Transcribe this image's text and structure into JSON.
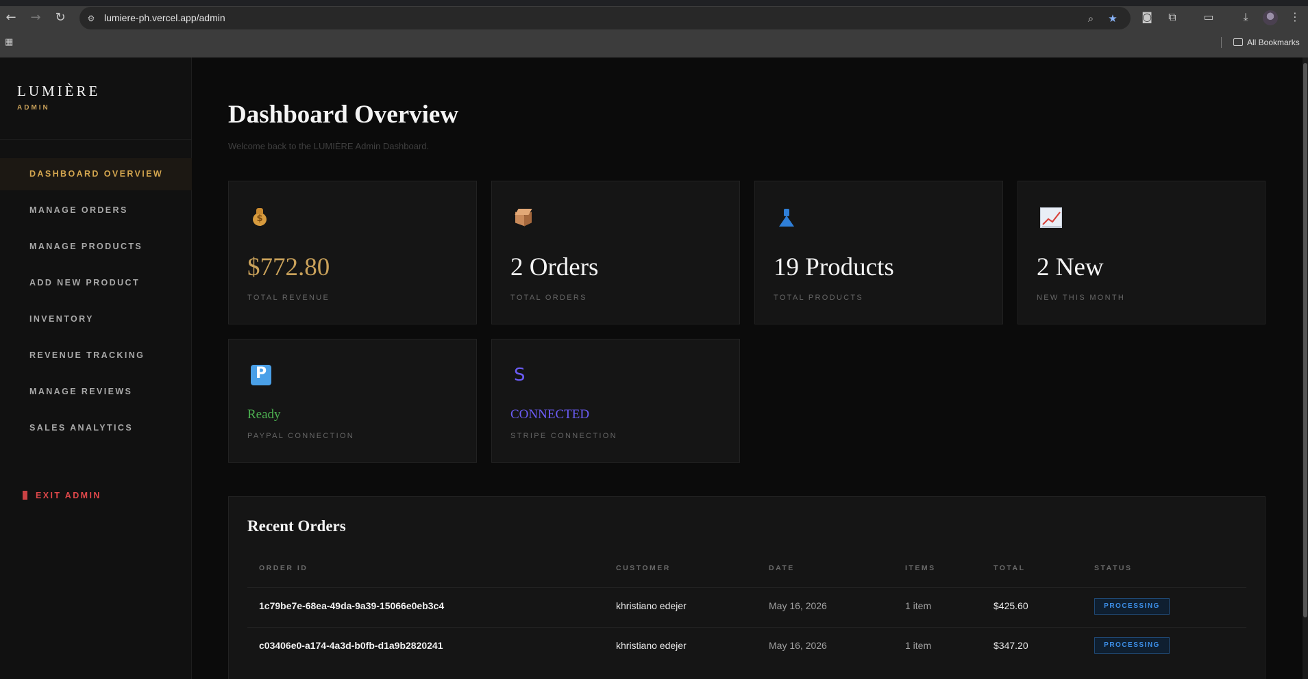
{
  "browser": {
    "url": "lumiere-ph.vercel.app/admin",
    "bookmarks_label": "All Bookmarks"
  },
  "sidebar": {
    "brand": "LUMIÈRE",
    "brand_sub": "ADMIN",
    "items": [
      {
        "label": "DASHBOARD OVERVIEW",
        "active": true
      },
      {
        "label": "MANAGE ORDERS"
      },
      {
        "label": "MANAGE PRODUCTS"
      },
      {
        "label": "ADD NEW PRODUCT"
      },
      {
        "label": "INVENTORY"
      },
      {
        "label": "REVENUE TRACKING"
      },
      {
        "label": "MANAGE REVIEWS"
      },
      {
        "label": "SALES ANALYTICS"
      }
    ],
    "exit_label": "EXIT ADMIN"
  },
  "header": {
    "title": "Dashboard Overview",
    "subtitle": "Welcome back to the LUMIÈRE Admin Dashboard."
  },
  "stats": [
    {
      "icon": "money-bag-icon",
      "value": "$772.80",
      "label": "TOTAL REVENUE",
      "color": "#c9a15a"
    },
    {
      "icon": "package-icon",
      "value": "2 Orders",
      "label": "TOTAL ORDERS",
      "color": "#f4f4f4"
    },
    {
      "icon": "dress-icon",
      "value": "19 Products",
      "label": "TOTAL PRODUCTS",
      "color": "#f4f4f4"
    },
    {
      "icon": "chart-increasing-icon",
      "value": "2 New",
      "label": "NEW THIS MONTH",
      "color": "#f4f4f4"
    }
  ],
  "connections": [
    {
      "icon": "paypal-p-icon",
      "icon_text": "P",
      "value": "Ready",
      "label": "PAYPAL CONNECTION",
      "color": "#4caf50"
    },
    {
      "icon": "stripe-s-icon",
      "icon_text": "S",
      "value": "CONNECTED",
      "label": "STRIPE CONNECTION",
      "color": "#6b5cf6"
    }
  ],
  "recent_orders": {
    "title": "Recent Orders",
    "columns": [
      "ORDER ID",
      "CUSTOMER",
      "DATE",
      "ITEMS",
      "TOTAL",
      "STATUS"
    ],
    "rows": [
      {
        "id": "1c79be7e-68ea-49da-9a39-15066e0eb3c4",
        "customer": "khristiano edejer",
        "date": "May 16, 2026",
        "items": "1 item",
        "total": "$425.60",
        "status": "PROCESSING"
      },
      {
        "id": "c03406e0-a174-4a3d-b0fb-d1a9b2820241",
        "customer": "khristiano edejer",
        "date": "May 16, 2026",
        "items": "1 item",
        "total": "$347.20",
        "status": "PROCESSING"
      }
    ]
  },
  "colors": {
    "accent_gold": "#c9a15a",
    "danger": "#e0484a",
    "status_blue": "#3d8fe8"
  }
}
